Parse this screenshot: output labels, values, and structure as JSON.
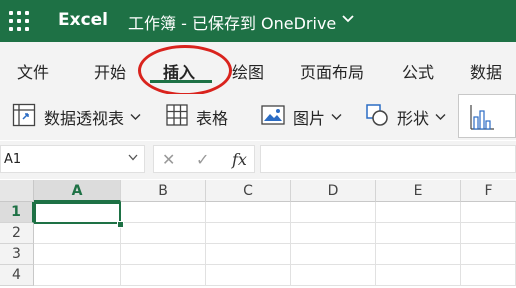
{
  "titlebar": {
    "app_name": "Excel",
    "doc_title": "工作簿 - 已保存到 OneDrive",
    "background": "#1e7145"
  },
  "tabs": [
    {
      "label": "文件"
    },
    {
      "label": "开始"
    },
    {
      "label": "插入",
      "active": true
    },
    {
      "label": "绘图"
    },
    {
      "label": "页面布局"
    },
    {
      "label": "公式"
    },
    {
      "label": "数据"
    }
  ],
  "highlight_color": "#d9231d",
  "ribbon": {
    "pivot_label": "数据透视表",
    "table_label": "表格",
    "pictures_label": "图片",
    "shapes_label": "形状"
  },
  "formula_bar": {
    "name_box_value": "A1",
    "fx_label": "fx",
    "cancel_glyph": "✕",
    "enter_glyph": "✓"
  },
  "grid": {
    "columns": [
      "A",
      "B",
      "C",
      "D",
      "E",
      "F"
    ],
    "rows": [
      "1",
      "2",
      "3",
      "4"
    ],
    "selected_cell": "A1"
  }
}
